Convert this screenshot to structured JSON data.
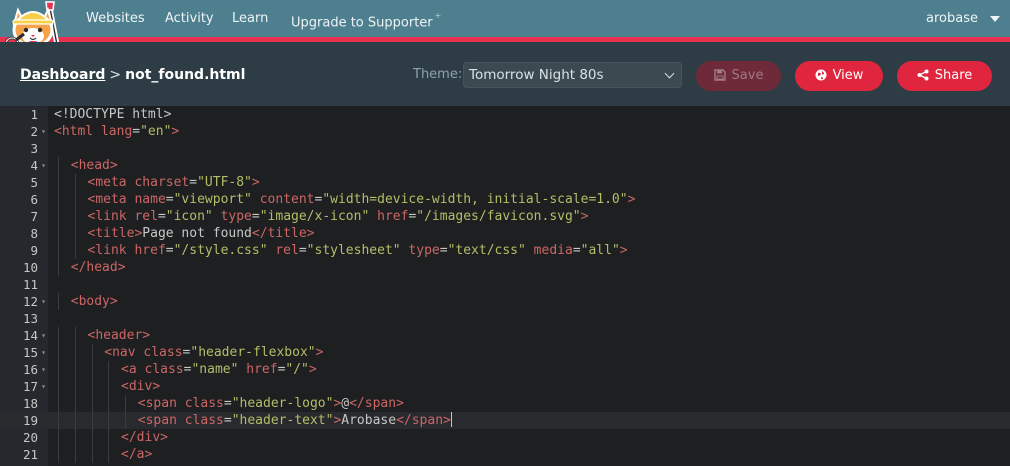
{
  "nav": {
    "links": [
      "Websites",
      "Activity",
      "Learn",
      "Upgrade to Supporter"
    ],
    "upgrade_mark": "+",
    "user": "arobase"
  },
  "editor_bar": {
    "dashboard_label": "Dashboard",
    "separator": ">",
    "filename": "not_found.html",
    "theme_label": "Theme:",
    "theme_value": "Tomorrow Night 80s",
    "save_label": "Save",
    "view_label": "View",
    "share_label": "Share"
  },
  "colors": {
    "nav_bg": "#4e7f8f",
    "accent": "#e93250",
    "button": "#e0263f",
    "editor_bg": "#1d1f21",
    "tag": "#cc6666",
    "string": "#b5bd68",
    "text": "#c5c8c6"
  },
  "icons": {
    "logo": "cat-logo",
    "save": "floppy-disk-icon",
    "view": "globe-icon",
    "share": "share-icon",
    "user_menu": "caret-down-icon"
  },
  "cursor_line": 19,
  "code_lines": [
    {
      "n": "1",
      "fold": false,
      "indent": 0,
      "tokens": [
        [
          "t",
          "<!DOCTYPE html>"
        ]
      ]
    },
    {
      "n": "2",
      "fold": true,
      "indent": 0,
      "tokens": [
        [
          "g",
          "<html "
        ],
        [
          "a",
          "lang"
        ],
        [
          "t",
          "="
        ],
        [
          "s",
          "\"en\""
        ],
        [
          "g",
          ">"
        ]
      ]
    },
    {
      "n": "3",
      "fold": false,
      "indent": 0,
      "tokens": []
    },
    {
      "n": "4",
      "fold": true,
      "indent": 1,
      "tokens": [
        [
          "g",
          "<head>"
        ]
      ]
    },
    {
      "n": "5",
      "fold": false,
      "indent": 2,
      "tokens": [
        [
          "g",
          "<meta "
        ],
        [
          "a",
          "charset"
        ],
        [
          "t",
          "="
        ],
        [
          "s",
          "\"UTF-8\""
        ],
        [
          "g",
          ">"
        ]
      ]
    },
    {
      "n": "6",
      "fold": false,
      "indent": 2,
      "tokens": [
        [
          "g",
          "<meta "
        ],
        [
          "a",
          "name"
        ],
        [
          "t",
          "="
        ],
        [
          "s",
          "\"viewport\""
        ],
        [
          "t",
          " "
        ],
        [
          "a",
          "content"
        ],
        [
          "t",
          "="
        ],
        [
          "s",
          "\"width=device-width, initial-scale=1.0\""
        ],
        [
          "g",
          ">"
        ]
      ]
    },
    {
      "n": "7",
      "fold": false,
      "indent": 2,
      "tokens": [
        [
          "g",
          "<link "
        ],
        [
          "a",
          "rel"
        ],
        [
          "t",
          "="
        ],
        [
          "s",
          "\"icon\""
        ],
        [
          "t",
          " "
        ],
        [
          "a",
          "type"
        ],
        [
          "t",
          "="
        ],
        [
          "s",
          "\"image/x-icon\""
        ],
        [
          "t",
          " "
        ],
        [
          "a",
          "href"
        ],
        [
          "t",
          "="
        ],
        [
          "s",
          "\"/images/favicon.svg\""
        ],
        [
          "g",
          ">"
        ]
      ]
    },
    {
      "n": "8",
      "fold": false,
      "indent": 2,
      "tokens": [
        [
          "g",
          "<title>"
        ],
        [
          "t",
          "Page not found"
        ],
        [
          "g",
          "</title>"
        ]
      ]
    },
    {
      "n": "9",
      "fold": false,
      "indent": 2,
      "tokens": [
        [
          "g",
          "<link "
        ],
        [
          "a",
          "href"
        ],
        [
          "t",
          "="
        ],
        [
          "s",
          "\"/style.css\""
        ],
        [
          "t",
          " "
        ],
        [
          "a",
          "rel"
        ],
        [
          "t",
          "="
        ],
        [
          "s",
          "\"stylesheet\""
        ],
        [
          "t",
          " "
        ],
        [
          "a",
          "type"
        ],
        [
          "t",
          "="
        ],
        [
          "s",
          "\"text/css\""
        ],
        [
          "t",
          " "
        ],
        [
          "a",
          "media"
        ],
        [
          "t",
          "="
        ],
        [
          "s",
          "\"all\""
        ],
        [
          "g",
          ">"
        ]
      ]
    },
    {
      "n": "10",
      "fold": false,
      "indent": 1,
      "tokens": [
        [
          "g",
          "</head>"
        ]
      ]
    },
    {
      "n": "11",
      "fold": false,
      "indent": 0,
      "tokens": []
    },
    {
      "n": "12",
      "fold": true,
      "indent": 1,
      "tokens": [
        [
          "g",
          "<body>"
        ]
      ]
    },
    {
      "n": "13",
      "fold": false,
      "indent": 0,
      "tokens": []
    },
    {
      "n": "14",
      "fold": true,
      "indent": 2,
      "tokens": [
        [
          "g",
          "<header>"
        ]
      ]
    },
    {
      "n": "15",
      "fold": true,
      "indent": 3,
      "tokens": [
        [
          "g",
          "<nav "
        ],
        [
          "a",
          "class"
        ],
        [
          "t",
          "="
        ],
        [
          "s",
          "\"header-flexbox\""
        ],
        [
          "g",
          ">"
        ]
      ]
    },
    {
      "n": "16",
      "fold": true,
      "indent": 4,
      "tokens": [
        [
          "g",
          "<a "
        ],
        [
          "a",
          "class"
        ],
        [
          "t",
          "="
        ],
        [
          "s",
          "\"name\""
        ],
        [
          "t",
          " "
        ],
        [
          "a",
          "href"
        ],
        [
          "t",
          "="
        ],
        [
          "s",
          "\"/\""
        ],
        [
          "g",
          ">"
        ]
      ]
    },
    {
      "n": "17",
      "fold": true,
      "indent": 4,
      "tokens": [
        [
          "g",
          "<div>"
        ]
      ]
    },
    {
      "n": "18",
      "fold": false,
      "indent": 5,
      "tokens": [
        [
          "g",
          "<span "
        ],
        [
          "a",
          "class"
        ],
        [
          "t",
          "="
        ],
        [
          "s",
          "\"header-logo\""
        ],
        [
          "g",
          ">"
        ],
        [
          "t",
          "@"
        ],
        [
          "g",
          "</span>"
        ]
      ]
    },
    {
      "n": "19",
      "fold": false,
      "indent": 5,
      "tokens": [
        [
          "g",
          "<span "
        ],
        [
          "a",
          "class"
        ],
        [
          "t",
          "="
        ],
        [
          "s",
          "\"header-text\""
        ],
        [
          "g",
          ">"
        ],
        [
          "t",
          "Arobase"
        ],
        [
          "g",
          "</span>"
        ]
      ]
    },
    {
      "n": "20",
      "fold": false,
      "indent": 4,
      "tokens": [
        [
          "g",
          "</div>"
        ]
      ]
    },
    {
      "n": "21",
      "fold": false,
      "indent": 4,
      "tokens": [
        [
          "g",
          "</a>"
        ]
      ]
    }
  ]
}
